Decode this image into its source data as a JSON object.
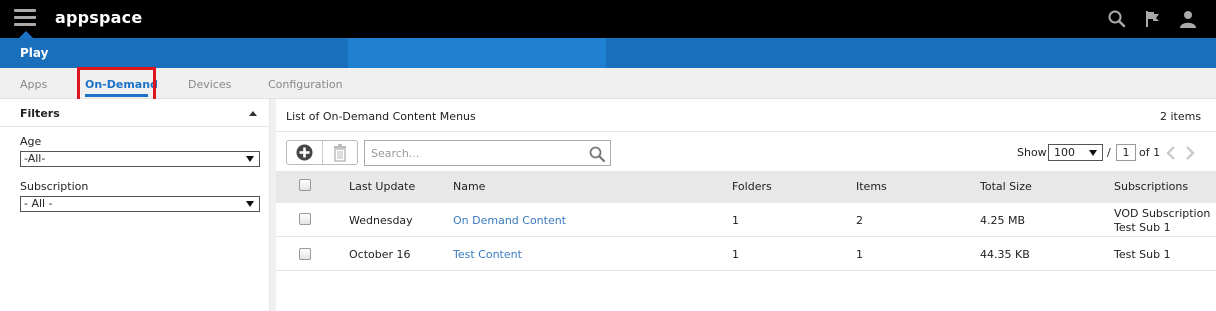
{
  "app": {
    "name": "appspace",
    "section": "Play"
  },
  "icons": {
    "menu": "hamburger-menu-icon",
    "search": "search-icon",
    "flag": "flag-icon",
    "user": "user-icon"
  },
  "tabs": [
    {
      "label": "Apps",
      "active": false
    },
    {
      "label": "On-Demand",
      "active": true
    },
    {
      "label": "Devices",
      "active": false
    },
    {
      "label": "Configuration",
      "active": false
    }
  ],
  "filters": {
    "title": "Filters",
    "age": {
      "label": "Age",
      "value": "-All-"
    },
    "subscription": {
      "label": "Subscription",
      "value": "- All -"
    }
  },
  "list": {
    "title": "List of On-Demand Content Menus",
    "count": "2 items",
    "search_placeholder": "Search...",
    "show_label": "Show",
    "page_size": "100",
    "page_sep": "/",
    "page": "1",
    "of_label": "of 1"
  },
  "table": {
    "columns": [
      "Last Update",
      "Name",
      "Folders",
      "Items",
      "Total Size",
      "Subscriptions"
    ],
    "rows": [
      {
        "last_update": "Wednesday",
        "name": "On Demand Content",
        "folders": "1",
        "items": "2",
        "total_size": "4.25 MB",
        "subscriptions": [
          "VOD Subscription",
          "Test Sub 1"
        ]
      },
      {
        "last_update": "October 16",
        "name": "Test Content",
        "folders": "1",
        "items": "1",
        "total_size": "44.35 KB",
        "subscriptions": [
          "Test Sub 1"
        ]
      }
    ]
  },
  "colors": {
    "topbar": "#000000",
    "brand_blue": "#1a6fbd",
    "link": "#3b7bbf",
    "highlight": "#e0141b"
  }
}
